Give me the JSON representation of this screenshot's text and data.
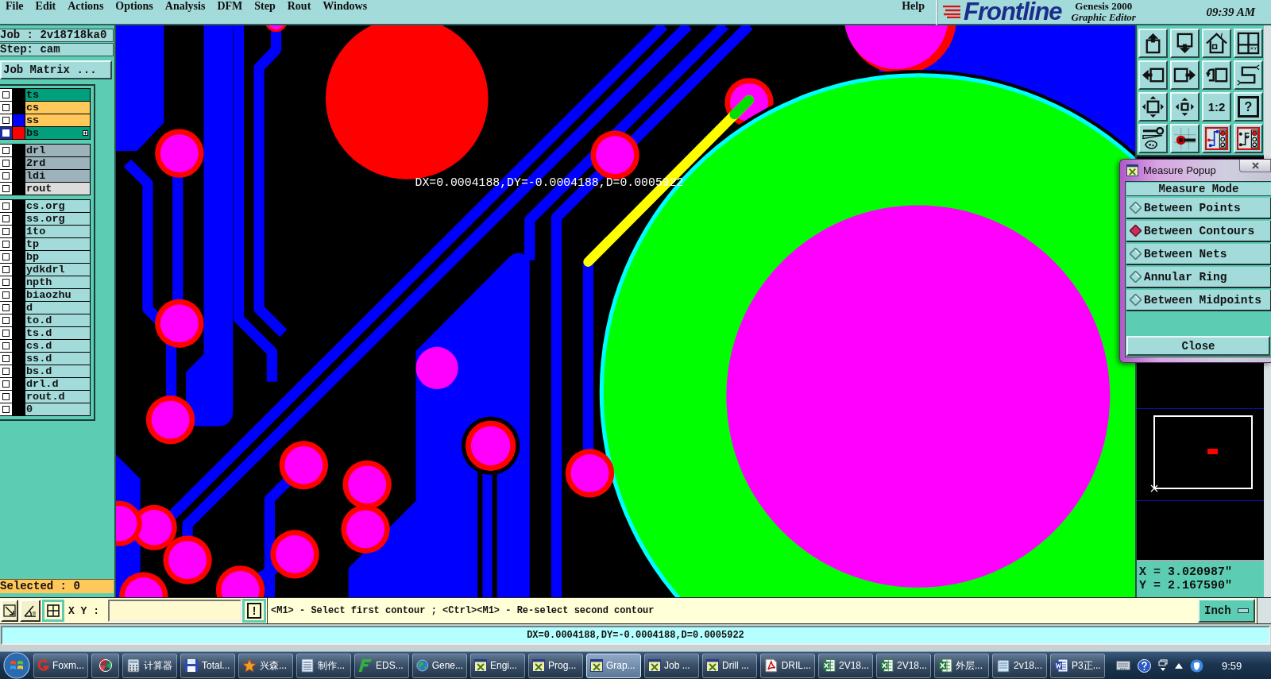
{
  "menu_bar": {
    "items": [
      "File",
      "Edit",
      "Actions",
      "Options",
      "Analysis",
      "DFM",
      "Step",
      "Rout",
      "Windows"
    ],
    "help": "Help"
  },
  "logo": {
    "brand": "Frontline",
    "product": "Genesis 2000",
    "subtitle": "Graphic Editor",
    "time": "09:39 AM"
  },
  "job_panel": {
    "job": "Job : 2v18718ka0",
    "step": "Step: cam",
    "matrix_button": "Job Matrix ..."
  },
  "layers": {
    "groups": [
      [
        {
          "name": "ts",
          "kind": "solder_mask",
          "checked": false,
          "selected": false
        },
        {
          "name": "cs",
          "kind": "signal",
          "checked": false,
          "selected": false
        },
        {
          "name": "ss",
          "kind": "signal",
          "color": "#0000ff",
          "checked": false,
          "selected": false
        },
        {
          "name": "bs",
          "kind": "solder_mask",
          "color": "#ff0000",
          "checked": false,
          "selected": true
        }
      ],
      [
        {
          "name": "drl",
          "kind": "drill",
          "checked": false,
          "selected": false
        },
        {
          "name": "2rd",
          "kind": "drill",
          "checked": false,
          "selected": false
        },
        {
          "name": "ldi",
          "kind": "drill",
          "checked": false,
          "selected": false
        },
        {
          "name": "rout",
          "kind": "rout",
          "checked": false,
          "selected": false
        }
      ],
      [
        {
          "name": "cs.org",
          "kind": "document",
          "checked": false,
          "selected": false
        },
        {
          "name": "ss.org",
          "kind": "document",
          "checked": false,
          "selected": false
        },
        {
          "name": "1to",
          "kind": "document",
          "checked": false,
          "selected": false
        },
        {
          "name": "tp",
          "kind": "document",
          "checked": false,
          "selected": false
        },
        {
          "name": "bp",
          "kind": "document",
          "checked": false,
          "selected": false
        },
        {
          "name": "ydkdrl",
          "kind": "document",
          "checked": false,
          "selected": false
        },
        {
          "name": "npth",
          "kind": "document",
          "checked": false,
          "selected": false
        },
        {
          "name": "biaozhu",
          "kind": "document",
          "checked": false,
          "selected": false
        },
        {
          "name": "d",
          "kind": "document",
          "checked": false,
          "selected": false
        },
        {
          "name": "to.d",
          "kind": "document",
          "checked": false,
          "selected": false
        },
        {
          "name": "ts.d",
          "kind": "document",
          "checked": false,
          "selected": false
        },
        {
          "name": "cs.d",
          "kind": "document",
          "checked": false,
          "selected": false
        },
        {
          "name": "ss.d",
          "kind": "document",
          "checked": false,
          "selected": false
        },
        {
          "name": "bs.d",
          "kind": "document",
          "checked": false,
          "selected": false
        },
        {
          "name": "drl.d",
          "kind": "document",
          "checked": false,
          "selected": false
        },
        {
          "name": "rout.d",
          "kind": "document",
          "checked": false,
          "selected": false
        },
        {
          "name": "0",
          "kind": "document",
          "checked": false,
          "selected": false
        }
      ]
    ]
  },
  "selected_count": "Selected : 0",
  "canvas": {
    "measurement_label": "DX=0.0004188,DY=-0.0004188,D=0.0005922"
  },
  "toolbar": {
    "buttons": [
      {
        "kind": "layer_up"
      },
      {
        "kind": "layer_down"
      },
      {
        "kind": "home"
      },
      {
        "kind": "window_grid"
      },
      {
        "kind": "arrow_left_box"
      },
      {
        "kind": "box_arrow_right"
      },
      {
        "kind": "undo_box"
      },
      {
        "kind": "s_curve"
      },
      {
        "kind": "zoom_fit"
      },
      {
        "kind": "zoom_box"
      },
      {
        "kind": "text",
        "label": "1:2"
      },
      {
        "kind": "framed_text",
        "label": "?"
      },
      {
        "kind": "tools"
      },
      {
        "kind": "probe"
      },
      {
        "kind": "net_a"
      },
      {
        "kind": "net_b"
      }
    ]
  },
  "coordinates": {
    "x": "X = 3.020987\"",
    "y": "Y = 2.167590\""
  },
  "measure_popup": {
    "title": "Measure Popup",
    "heading": "Measure Mode",
    "modes": [
      {
        "label": "Between Points",
        "selected": false
      },
      {
        "label": "Between Contours",
        "selected": true
      },
      {
        "label": "Between Nets",
        "selected": false
      },
      {
        "label": "Annular Ring",
        "selected": false
      },
      {
        "label": "Between Midpoints",
        "selected": false
      }
    ],
    "close_button": "Close"
  },
  "command_bar": {
    "xy_label": "X Y :",
    "exec_button": "!",
    "prompt": "<M1> - Select first contour ; <Ctrl><M1> - Re-select second contour",
    "units_button": "Inch"
  },
  "status_bar": {
    "text": "DX=0.0004188,DY=-0.0004188,D=0.0005922"
  },
  "taskbar": {
    "items": [
      {
        "label": "Foxm...",
        "kind": "swirl",
        "selected": false
      },
      {
        "kind": "pinwheel",
        "selected": false
      },
      {
        "label": "计算器",
        "kind": "calculator",
        "selected": false
      },
      {
        "label": "Total...",
        "kind": "floppy",
        "selected": false
      },
      {
        "label": "兴森...",
        "kind": "star",
        "selected": false
      },
      {
        "label": "制作...",
        "kind": "list",
        "selected": false
      },
      {
        "label": "EDS...",
        "kind": "slanted_logo",
        "selected": false
      },
      {
        "label": "Gene...",
        "kind": "globe",
        "selected": false
      },
      {
        "label": "Engi...",
        "kind": "x_window",
        "selected": false
      },
      {
        "label": "Prog...",
        "kind": "x_window",
        "selected": false
      },
      {
        "label": "Grap...",
        "kind": "x_window",
        "selected": true
      },
      {
        "label": "Job ...",
        "kind": "x_window",
        "selected": false
      },
      {
        "label": "Drill ...",
        "kind": "x_window",
        "selected": false
      },
      {
        "label": "DRIL...",
        "kind": "pdf",
        "selected": false
      },
      {
        "label": "2V18...",
        "kind": "spreadsheet",
        "selected": false
      },
      {
        "label": "2V18...",
        "kind": "spreadsheet",
        "selected": false
      },
      {
        "label": "外层...",
        "kind": "spreadsheet",
        "selected": false
      },
      {
        "label": "2v18...",
        "kind": "notepad",
        "selected": false
      },
      {
        "label": "P3正...",
        "kind": "word",
        "selected": false
      }
    ],
    "clock": "9:59"
  }
}
